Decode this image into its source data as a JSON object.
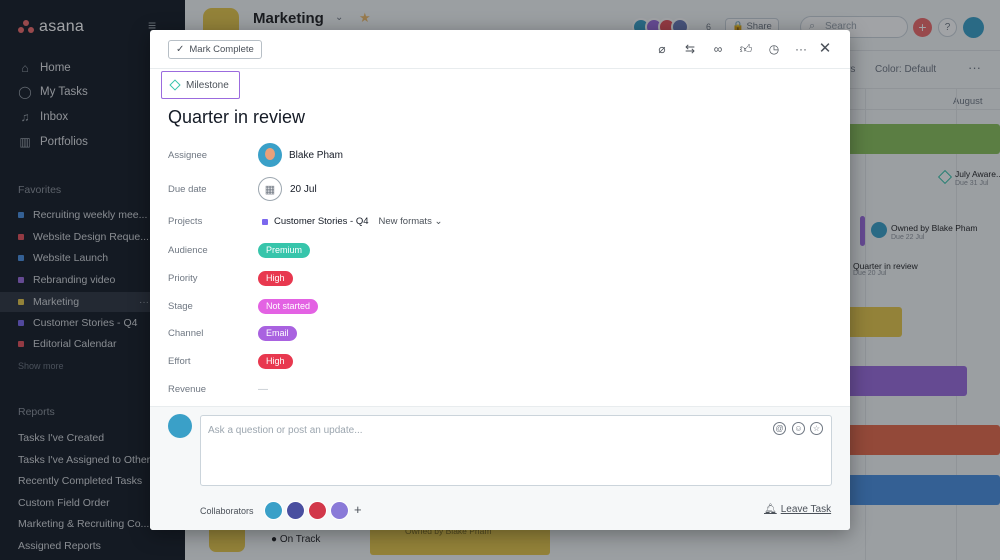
{
  "sidebar": {
    "logo": "asana",
    "nav": [
      {
        "label": "Home",
        "icon": "home-icon"
      },
      {
        "label": "My Tasks",
        "icon": "check-circle-icon"
      },
      {
        "label": "Inbox",
        "icon": "bell-icon"
      },
      {
        "label": "Portfolios",
        "icon": "bar-chart-icon"
      }
    ],
    "favorites_label": "Favorites",
    "favorites": [
      {
        "label": "Recruiting weekly mee...",
        "color": "#4a90e2"
      },
      {
        "label": "Website Design Reque...",
        "color": "#e8505b"
      },
      {
        "label": "Website Launch",
        "color": "#4a90e2"
      },
      {
        "label": "Rebranding video",
        "color": "#9b6bde"
      },
      {
        "label": "Marketing",
        "color": "#e8c84a",
        "active": true,
        "more": "···"
      },
      {
        "label": "Customer Stories - Q4",
        "color": "#7b68ee"
      },
      {
        "label": "Editorial Calendar",
        "color": "#e8505b"
      }
    ],
    "show_more": "Show more",
    "reports_label": "Reports",
    "reports": [
      "Tasks I've Created",
      "Tasks I've Assigned to Others",
      "Recently Completed Tasks",
      "Custom Field Order",
      "Marketing & Recruiting Co...",
      "Assigned Reports"
    ]
  },
  "header": {
    "project_title": "Marketing",
    "member_count": "6",
    "share_label": "Share",
    "search_placeholder": "Search",
    "add_label": "+",
    "help_label": "?",
    "toolbar_rules": "rs",
    "color_default": "Color: Default",
    "more": "···"
  },
  "timeline": {
    "month": "August",
    "items": [
      {
        "label": "July Aware...",
        "sub": "Due 31 Jul"
      },
      {
        "label": "Owned by Blake Pham",
        "sub": "Due 22 Jul"
      },
      {
        "label": "Quarter in review",
        "sub": "Due 20 Jul"
      }
    ],
    "bottom_status": "On Track",
    "bottom_owner": "Owned by Blake Pham"
  },
  "task": {
    "mark_complete": "Mark Complete",
    "milestone_label": "Milestone",
    "title": "Quarter in review",
    "fields": {
      "assignee": {
        "label": "Assignee",
        "value": "Blake Pham"
      },
      "due_date": {
        "label": "Due date",
        "value": "20 Jul"
      },
      "projects": {
        "label": "Projects",
        "value": "Customer Stories - Q4",
        "section": "New formats"
      },
      "audience": {
        "label": "Audience",
        "value": "Premium",
        "color": "#37c5ab"
      },
      "priority": {
        "label": "Priority",
        "value": "High",
        "color": "#e8384f"
      },
      "stage": {
        "label": "Stage",
        "value": "Not started",
        "color": "#e362e3"
      },
      "channel": {
        "label": "Channel",
        "value": "Email",
        "color": "#a962e0"
      },
      "effort": {
        "label": "Effort",
        "value": "High",
        "color": "#e8384f"
      },
      "revenue": {
        "label": "Revenue",
        "value": "—"
      }
    },
    "comment_placeholder": "Ask a question or post an update...",
    "collaborators_label": "Collaborators",
    "collaborator_add": "+",
    "leave_task": "Leave Task"
  }
}
